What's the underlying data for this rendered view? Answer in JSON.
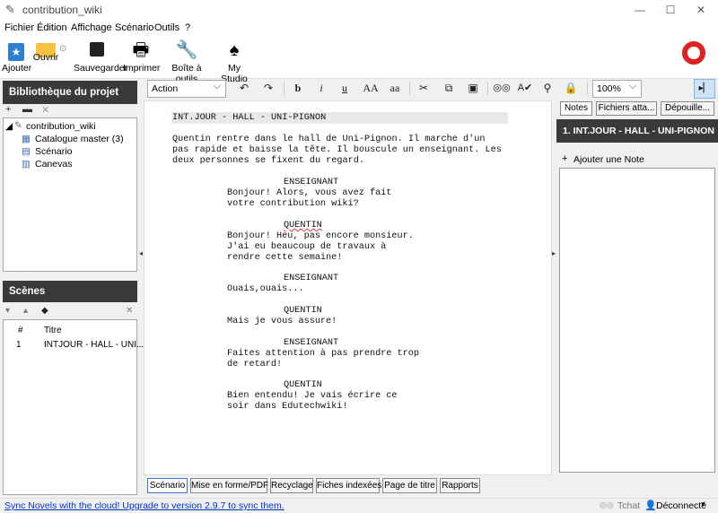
{
  "window": {
    "title": "contribution_wiki",
    "minimize": "—",
    "maximize": "☐",
    "close": "✕"
  },
  "menu": [
    "Fichier",
    "Édition",
    "Affichage",
    "Scénario",
    "Outils",
    "?"
  ],
  "toolbar": {
    "add": "Ajouter",
    "open": "Ouvrir",
    "save": "Sauvegarder",
    "print": "Imprimer",
    "toolbox": "Boîte à outils",
    "studio": "My Studio"
  },
  "library": {
    "header": "Bibliothèque du projet",
    "root": "contribution_wiki",
    "items": [
      "Catalogue master (3)",
      "Scénario",
      "Canevas"
    ]
  },
  "scenes": {
    "header": "Scènes",
    "col_num": "#",
    "col_title": "Titre",
    "rows": [
      {
        "num": "1",
        "title": "INTJOUR - HALL - UNI..."
      }
    ]
  },
  "format": {
    "style": "Action",
    "bold": "b",
    "italic": "i",
    "underline": "u",
    "upper": "AA",
    "lower": "aa",
    "zoom": "100%"
  },
  "script": {
    "heading": "INT.JOUR - HALL - UNI-PIGNON",
    "action": [
      "Quentin rentre dans le hall de Uni-Pignon. Il marche d'un",
      "pas rapide et baisse la tête. Il bouscule un enseignant. Les",
      "deux personnes se fixent du regard."
    ],
    "blocks": [
      {
        "character": "ENSEIGNANT",
        "lines": [
          "Bonjour! Alors, vous avez fait",
          "votre contribution wiki?"
        ]
      },
      {
        "character": "QUENTIN",
        "lines": [
          "Bonjour! Heu, pas encore monsieur.",
          "J'ai eu beaucoup de travaux à",
          "rendre cette semaine!"
        ]
      },
      {
        "character": "ENSEIGNANT",
        "lines": [
          "Ouais,ouais..."
        ]
      },
      {
        "character": "QUENTIN",
        "lines": [
          "Mais je vous assure!"
        ]
      },
      {
        "character": "ENSEIGNANT",
        "lines": [
          "Faites attention à pas prendre trop",
          "de retard!"
        ]
      },
      {
        "character": "QUENTIN",
        "lines": [
          "Bien entendu! Je vais écrire ce",
          "soir dans Edutechwiki!"
        ]
      }
    ]
  },
  "bottom_tabs": [
    "Scénario",
    "Mise en forme/PDF",
    "Recyclage",
    "Fiches indexées",
    "Page de titre",
    "Rapports"
  ],
  "right_panel": {
    "tabs": [
      "Notes",
      "Fichiers atta...",
      "Dépouille..."
    ],
    "scene_header": "1. INT.JOUR - HALL - UNI-PIGNON",
    "add_note": "Ajouter une Note"
  },
  "status": {
    "sync": "Sync Novels with the cloud! Upgrade to version 2.9.7 to sync them.",
    "chat": "Tchat",
    "connection": "Déconnecté"
  },
  "colors": {
    "header_bg": "#3a3a3a",
    "link": "#0033cc",
    "spell": "#dd3333"
  }
}
